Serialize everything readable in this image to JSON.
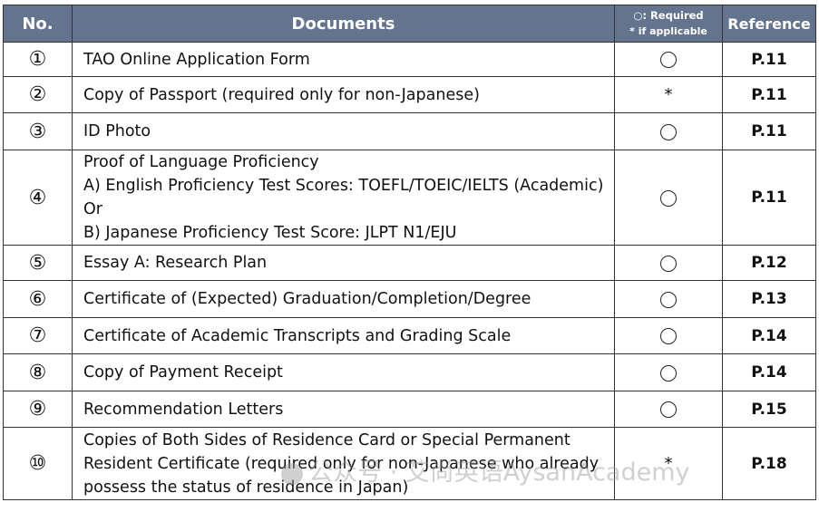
{
  "header": {
    "no": "No.",
    "documents": "Documents",
    "required_line1": "○: Required",
    "required_line2": "* if applicable",
    "reference": "Reference"
  },
  "rows": [
    {
      "no": "①",
      "lines": [
        "TAO Online Application Form"
      ],
      "mark": "circle",
      "ref": "P.11"
    },
    {
      "no": "②",
      "lines": [
        "Copy of Passport (required only for non-Japanese)"
      ],
      "mark": "*",
      "ref": "P.11"
    },
    {
      "no": "③",
      "lines": [
        "ID Photo"
      ],
      "mark": "circle",
      "ref": "P.11"
    },
    {
      "no": "④",
      "lines": [
        "Proof of Language Proficiency",
        "A) English Proficiency Test Scores: TOEFL/TOEIC/IELTS (Academic)",
        "Or",
        "B) Japanese Proficiency Test Score: JLPT N1/EJU"
      ],
      "mark": "circle",
      "ref": "P.11"
    },
    {
      "no": "⑤",
      "lines": [
        "Essay A: Research Plan"
      ],
      "mark": "circle",
      "ref": "P.12"
    },
    {
      "no": "⑥",
      "lines": [
        "Certificate of (Expected) Graduation/Completion/Degree"
      ],
      "mark": "circle",
      "ref": "P.13"
    },
    {
      "no": "⑦",
      "lines": [
        "Certificate of Academic Transcripts and Grading Scale"
      ],
      "mark": "circle",
      "ref": "P.14"
    },
    {
      "no": "⑧",
      "lines": [
        "Copy of Payment Receipt"
      ],
      "mark": "circle",
      "ref": "P.14"
    },
    {
      "no": "⑨",
      "lines": [
        "Recommendation Letters"
      ],
      "mark": "circle",
      "ref": "P.15"
    },
    {
      "no": "⑩",
      "lines": [
        "Copies of Both Sides of Residence Card or Special Permanent",
        "Resident Certificate (required only for non-Japanese who already",
        "possess the status of residence in Japan)"
      ],
      "mark": "*",
      "ref": "P.18"
    }
  ],
  "watermark": "公众号 · 艾尚英语AysanAcademy"
}
